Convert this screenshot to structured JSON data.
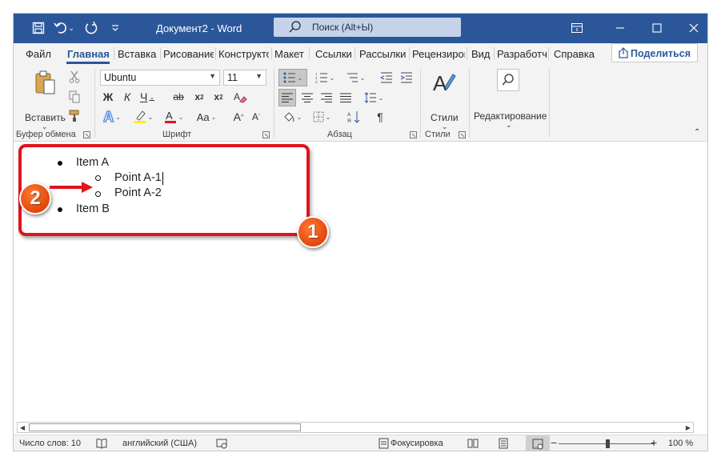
{
  "window": {
    "title": "Документ2  -  Word",
    "search_placeholder": "Поиск (Alt+Ы)",
    "accent": "#2b579a"
  },
  "tabs": [
    "Файл",
    "Главная",
    "Вставка",
    "Рисование",
    "Конструктор",
    "Макет",
    "Ссылки",
    "Рассылки",
    "Рецензирование",
    "Вид",
    "Разработчик",
    "Справка"
  ],
  "share_label": "Поделиться",
  "ribbon": {
    "clipboard": {
      "paste_label": "Вставить",
      "group_label": "Буфер обмена"
    },
    "font": {
      "font_name": "Ubuntu",
      "font_size": "11",
      "group_label": "Шрифт"
    },
    "paragraph": {
      "group_label": "Абзац"
    },
    "styles": {
      "label": "Стили",
      "group_label": "Стили"
    },
    "editing": {
      "label": "Редактирование"
    }
  },
  "document": {
    "items": [
      {
        "level": 1,
        "text": "Item A"
      },
      {
        "level": 2,
        "text": "Point A-1"
      },
      {
        "level": 2,
        "text": "Point A-2"
      },
      {
        "level": 1,
        "text": "Item B"
      }
    ]
  },
  "status": {
    "word_count": "Число слов: 10",
    "language": "английский (США)",
    "focus": "Фокусировка",
    "zoom": "100 %"
  },
  "annotations": {
    "badge1": "1",
    "badge2": "2",
    "color": "#e0141c"
  }
}
